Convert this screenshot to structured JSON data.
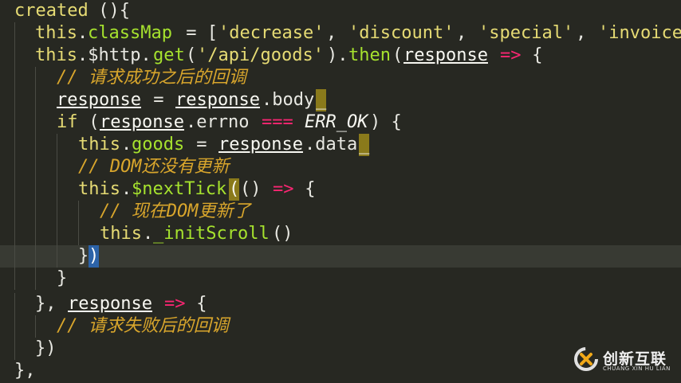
{
  "code": {
    "l1": {
      "a": "created",
      "b": " (){"
    },
    "l2": {
      "a": "this",
      "b": ".",
      "c": "classMap",
      "d": " = [",
      "e": "'decrease'",
      "f": ", ",
      "g": "'discount'",
      "h": ", ",
      "i": "'special'",
      "j": ", ",
      "k": "'invoice"
    },
    "l3": {
      "a": "this",
      "b": ".$http.",
      "c": "get",
      "d": "(",
      "e": "'/api/goods'",
      "f": ").",
      "g": "then",
      "h": "(",
      "i": "response",
      "j": " ",
      "k": "=>",
      "l": " {"
    },
    "l4": {
      "a": "// 请求成功之后的回调"
    },
    "l5": {
      "a": "response",
      "b": " = ",
      "c": "response",
      "d": ".body",
      "e": "_"
    },
    "l6": {
      "a": "if",
      "b": " (",
      "c": "response",
      "d": ".errno ",
      "e": "===",
      "f": " ",
      "g": "ERR_OK",
      "h": ") {"
    },
    "l7": {
      "a": "this",
      "b": ".",
      "c": "goods",
      "d": " = ",
      "e": "response",
      "f": ".data",
      "g": "_"
    },
    "l8": {
      "a": "// DOM还没有更新"
    },
    "l9": {
      "a": "this",
      "b": ".",
      "c": "$nextTick",
      "d": "(",
      "e": "() ",
      "f": "=>",
      "g": " {"
    },
    "l10": {
      "a": "// 现在DOM更新了"
    },
    "l11": {
      "a": "this",
      "b": ".",
      "c": "_initScroll",
      "d": "()"
    },
    "l12": {
      "a": "}",
      "b": ")"
    },
    "l13": {
      "a": "}"
    },
    "l14": {
      "a": "}, ",
      "b": "response",
      "c": " ",
      "d": "=>",
      "e": " {"
    },
    "l15": {
      "a": "// 请求失败后的回调"
    },
    "l16": {
      "a": "})"
    },
    "l17": {
      "a": "},"
    }
  },
  "logo": {
    "cn": "创新互联",
    "en": "CHUANG XIN HU LIAN",
    "icon": "chuangxin-logo-icon",
    "colors": {
      "ring": "#e0e0e0",
      "accent": "#f0a818"
    }
  },
  "theme": {
    "background": "#272822",
    "active_line": "#383a33",
    "keyword": "#e6db74",
    "comment": "#d9a62c",
    "operator": "#f92672",
    "function": "#a6e22e"
  }
}
